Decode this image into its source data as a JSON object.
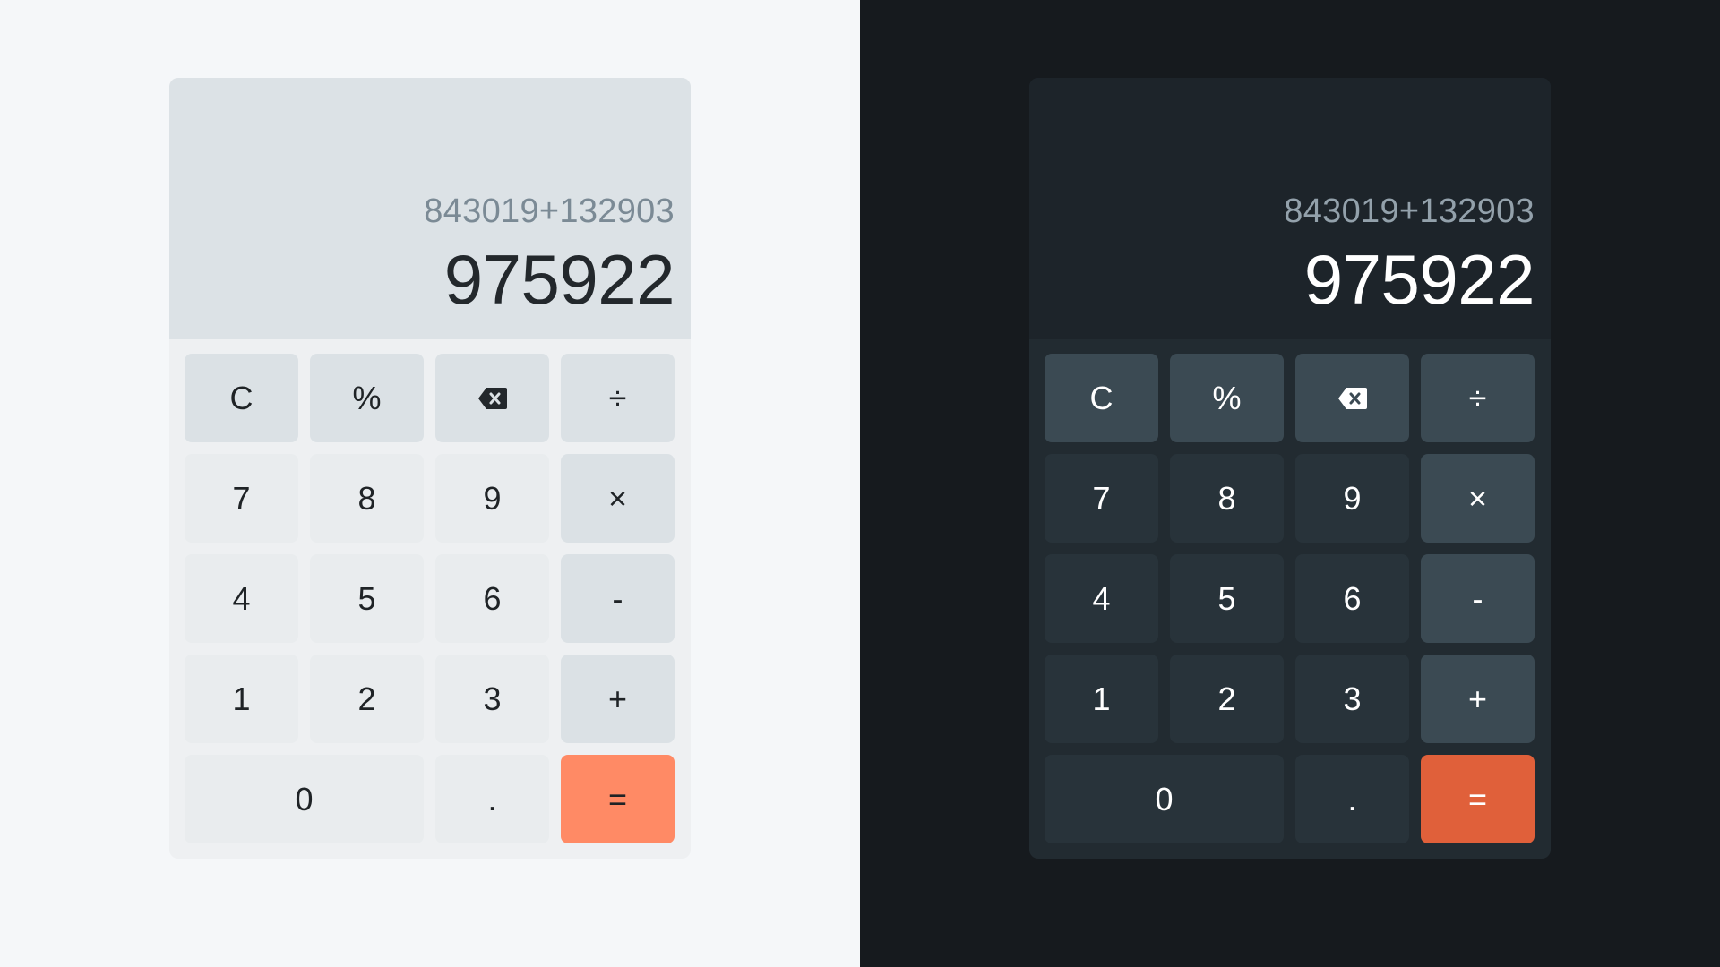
{
  "themes": {
    "light": {
      "background": "#f5f7f9",
      "display_bg": "#dce2e6",
      "keypad_bg": "#eef0f2",
      "number_key_bg": "#e9ecee",
      "function_key_bg": "#dbe1e5",
      "equals_key_bg": "#ff8a65",
      "text_color": "#1f2326",
      "expression_color": "#7b8a95"
    },
    "dark": {
      "background": "#161a1e",
      "display_bg": "#1d242a",
      "keypad_bg": "#222b31",
      "number_key_bg": "#28333a",
      "function_key_bg": "#3b4a53",
      "equals_key_bg": "#e0603a",
      "text_color": "#ffffff",
      "expression_color": "#93a1ab"
    }
  },
  "display": {
    "expression": "843019+132903",
    "result": "975922"
  },
  "keys": {
    "clear": "C",
    "percent": "%",
    "backspace_icon": "backspace-icon",
    "divide": "÷",
    "seven": "7",
    "eight": "8",
    "nine": "9",
    "multiply": "×",
    "four": "4",
    "five": "5",
    "six": "6",
    "subtract": "-",
    "one": "1",
    "two": "2",
    "three": "3",
    "add": "+",
    "zero": "0",
    "decimal": ".",
    "equals": "="
  }
}
